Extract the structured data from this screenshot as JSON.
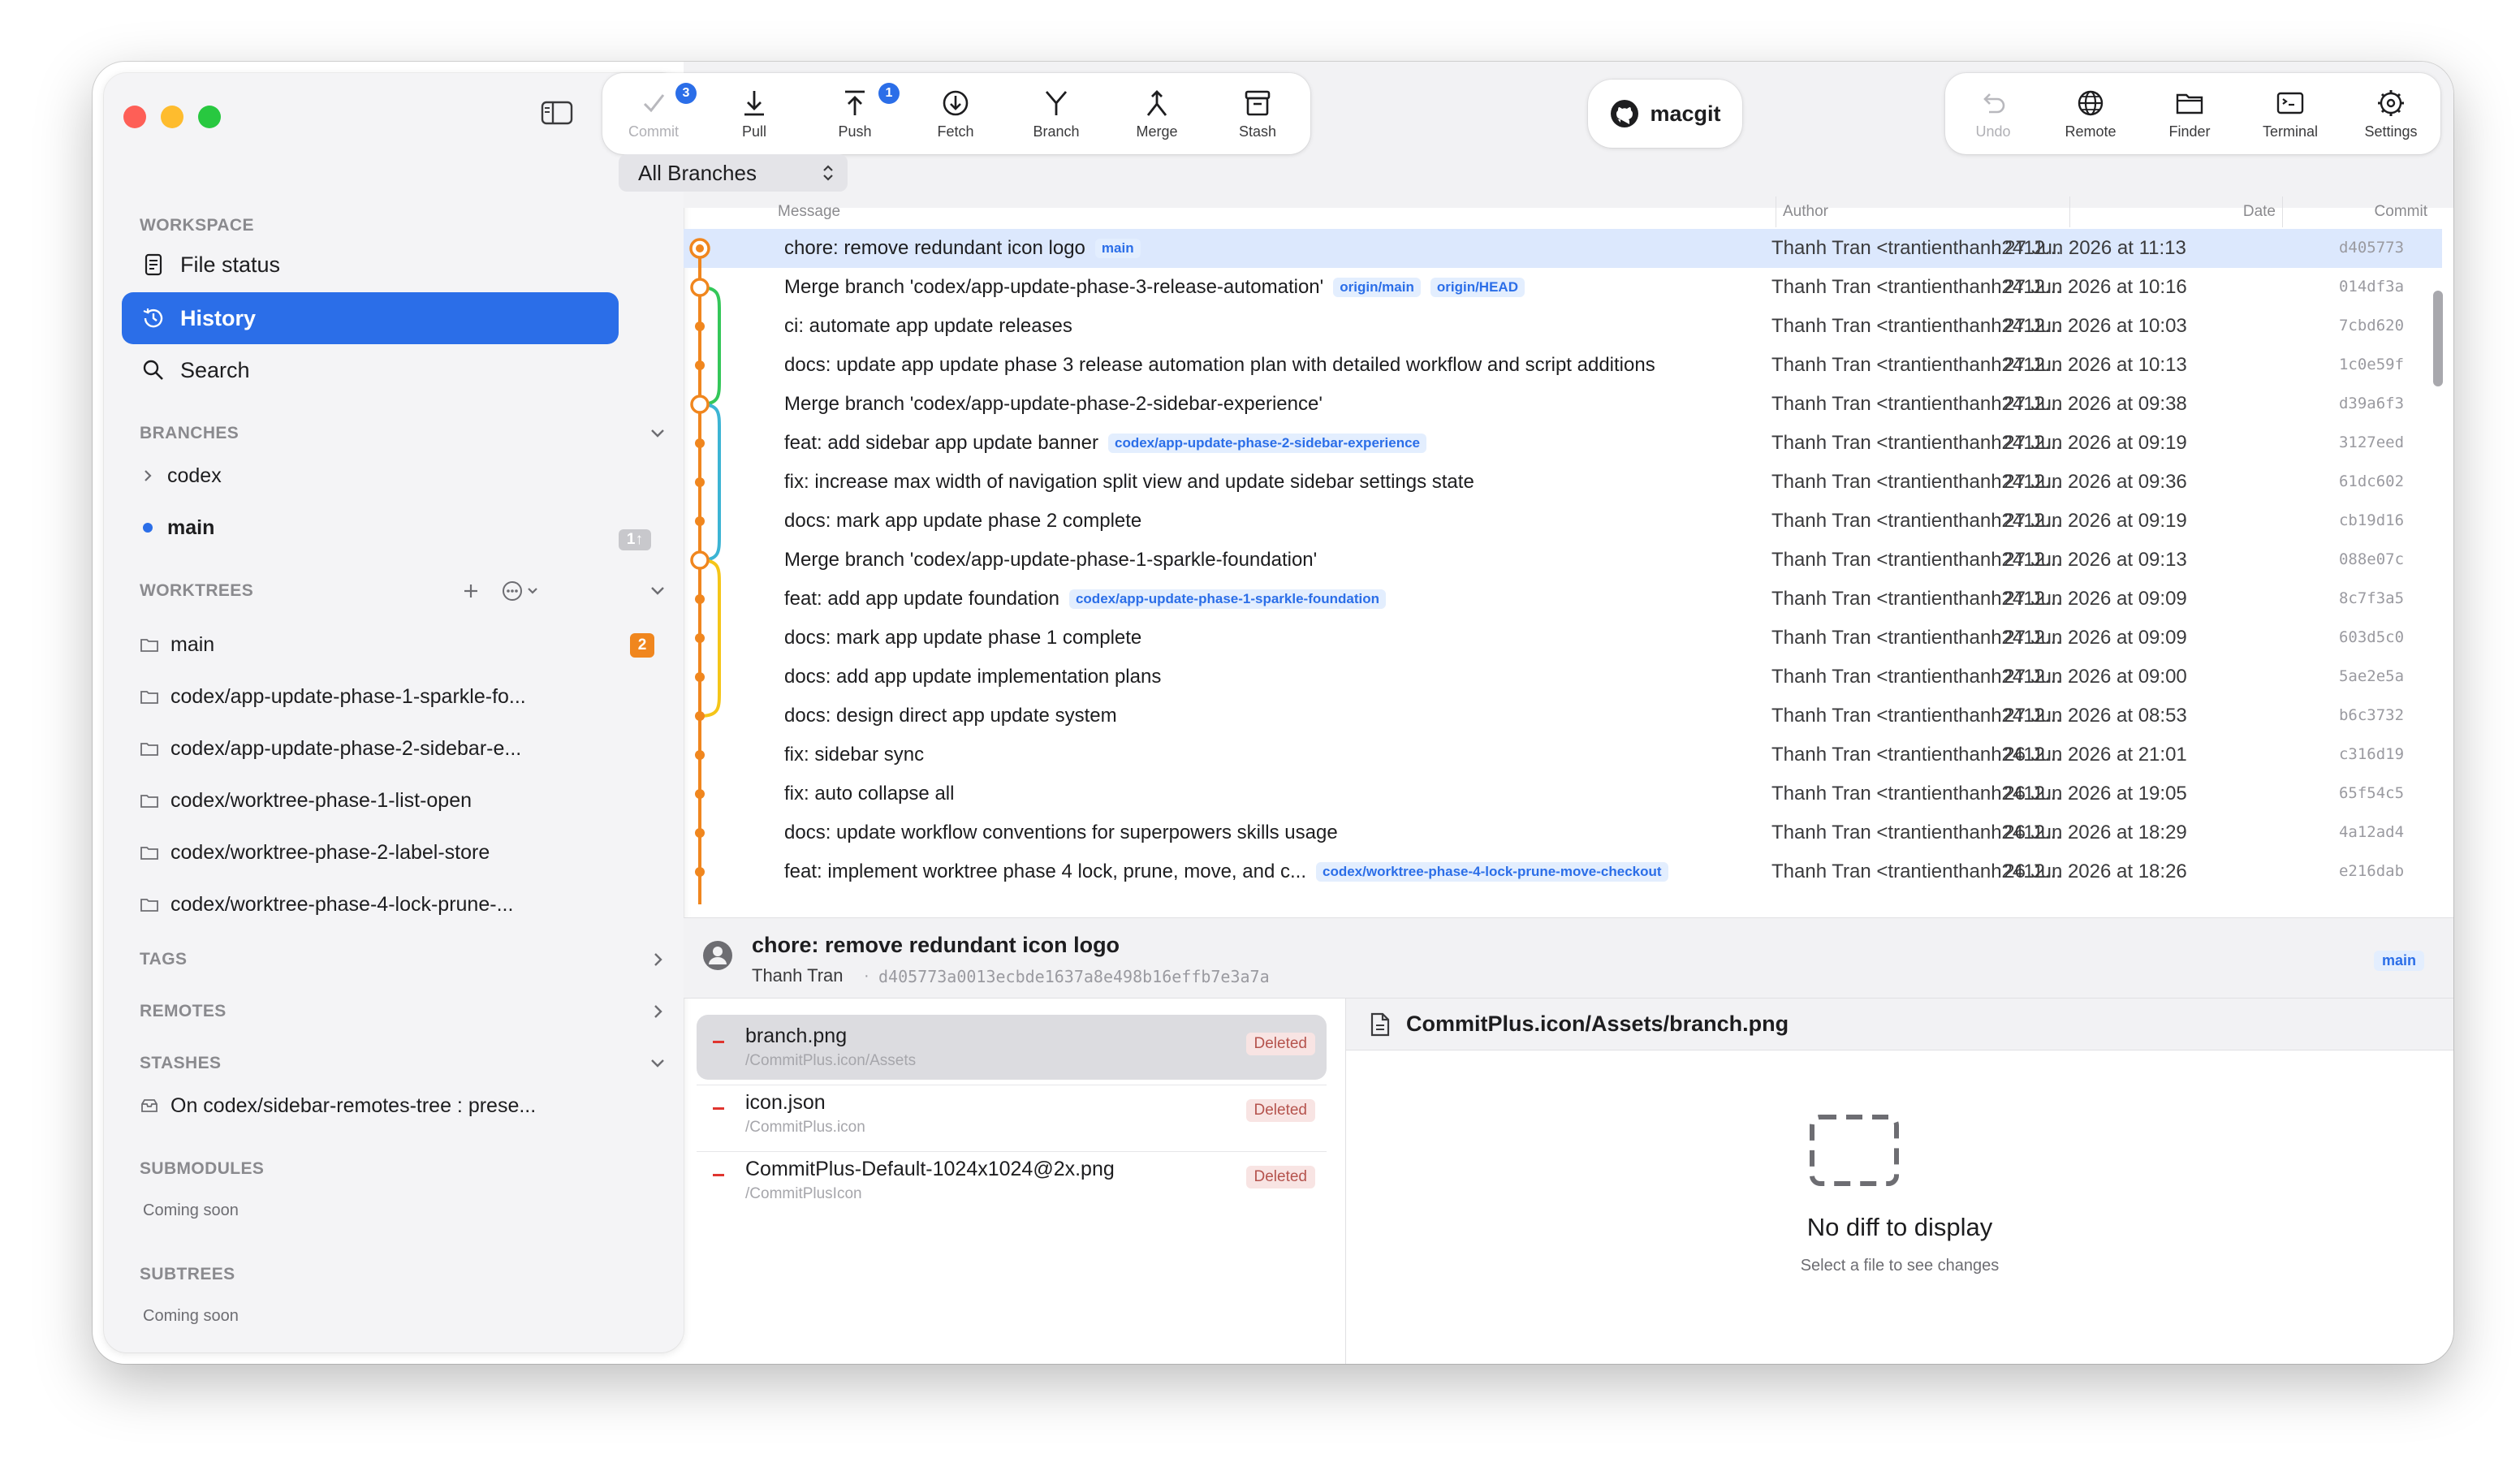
{
  "window": {
    "traffic_colors": [
      "#fe5f57",
      "#febc2e",
      "#28c840"
    ]
  },
  "sidebar": {
    "workspace_header": "WORKSPACE",
    "nav": [
      {
        "label": "File status",
        "icon": "file-status-icon"
      },
      {
        "label": "History",
        "icon": "history-icon",
        "active": true
      },
      {
        "label": "Search",
        "icon": "search-icon"
      }
    ],
    "branches_header": "BRANCHES",
    "branches": [
      {
        "label": "codex",
        "icon": "chevron-right-icon"
      },
      {
        "label": "main",
        "icon": "current-dot-icon",
        "badge": "1↑"
      }
    ],
    "worktrees_header": "WORKTREES",
    "worktrees": [
      {
        "label": "main",
        "badge": "2"
      },
      {
        "label": "codex/app-update-phase-1-sparkle-fo..."
      },
      {
        "label": "codex/app-update-phase-2-sidebar-e..."
      },
      {
        "label": "codex/worktree-phase-1-list-open"
      },
      {
        "label": "codex/worktree-phase-2-label-store"
      },
      {
        "label": "codex/worktree-phase-4-lock-prune-..."
      }
    ],
    "tags_header": "TAGS",
    "remotes_header": "REMOTES",
    "stashes_header": "STASHES",
    "stashes": [
      {
        "label": "On codex/sidebar-remotes-tree : prese..."
      }
    ],
    "submodules_header": "SUBMODULES",
    "submodules_note": "Coming soon",
    "subtrees_header": "SUBTREES",
    "subtrees_note": "Coming soon"
  },
  "toolbar": {
    "left": [
      {
        "label": "Commit",
        "icon": "checkmark-icon",
        "disabled": true,
        "badge": "3"
      },
      {
        "label": "Pull",
        "icon": "pull-icon"
      },
      {
        "label": "Push",
        "icon": "push-icon",
        "badge": "1"
      },
      {
        "label": "Fetch",
        "icon": "fetch-icon"
      },
      {
        "label": "Branch",
        "icon": "branch-icon"
      },
      {
        "label": "Merge",
        "icon": "merge-icon"
      },
      {
        "label": "Stash",
        "icon": "stash-icon"
      }
    ],
    "repo_name": "macgit",
    "right": [
      {
        "label": "Undo",
        "icon": "undo-icon",
        "disabled": true
      },
      {
        "label": "Remote",
        "icon": "globe-icon"
      },
      {
        "label": "Finder",
        "icon": "folder-icon"
      },
      {
        "label": "Terminal",
        "icon": "terminal-icon"
      },
      {
        "label": "Settings",
        "icon": "gear-icon"
      }
    ]
  },
  "branch_filter": {
    "value": "All Branches"
  },
  "history": {
    "columns": {
      "message": "Message",
      "author": "Author",
      "date": "Date",
      "commit": "Commit"
    },
    "rows": [
      {
        "message": "chore: remove redundant icon logo",
        "refs": [
          "main"
        ],
        "author": "Thanh Tran <trantienthanh2412...",
        "date": "27 Jun 2026 at 11:13",
        "hash": "d405773",
        "selected": true
      },
      {
        "message": "Merge branch 'codex/app-update-phase-3-release-automation'",
        "refs": [
          "origin/main",
          "origin/HEAD"
        ],
        "author": "Thanh Tran <trantienthanh2412...",
        "date": "27 Jun 2026 at 10:16",
        "hash": "014df3a"
      },
      {
        "message": "ci: automate app update releases",
        "refs": [],
        "author": "Thanh Tran <trantienthanh2412...",
        "date": "27 Jun 2026 at 10:03",
        "hash": "7cbd620"
      },
      {
        "message": "docs: update app update phase 3 release automation plan with detailed workflow and script additions",
        "refs": [],
        "author": "Thanh Tran <trantienthanh2412...",
        "date": "27 Jun 2026 at 10:13",
        "hash": "1c0e59f"
      },
      {
        "message": "Merge branch 'codex/app-update-phase-2-sidebar-experience'",
        "refs": [],
        "author": "Thanh Tran <trantienthanh2412...",
        "date": "27 Jun 2026 at 09:38",
        "hash": "d39a6f3"
      },
      {
        "message": "feat: add sidebar app update banner",
        "refs": [
          "codex/app-update-phase-2-sidebar-experience"
        ],
        "author": "Thanh Tran <trantienthanh2412...",
        "date": "27 Jun 2026 at 09:19",
        "hash": "3127eed"
      },
      {
        "message": "fix: increase max width of navigation split view and update sidebar settings state",
        "refs": [],
        "author": "Thanh Tran <trantienthanh2412...",
        "date": "27 Jun 2026 at 09:36",
        "hash": "61dc602"
      },
      {
        "message": "docs: mark app update phase 2 complete",
        "refs": [],
        "author": "Thanh Tran <trantienthanh2412...",
        "date": "27 Jun 2026 at 09:19",
        "hash": "cb19d16"
      },
      {
        "message": "Merge branch 'codex/app-update-phase-1-sparkle-foundation'",
        "refs": [],
        "author": "Thanh Tran <trantienthanh2412...",
        "date": "27 Jun 2026 at 09:13",
        "hash": "088e07c"
      },
      {
        "message": "feat: add app update foundation",
        "refs": [
          "codex/app-update-phase-1-sparkle-foundation"
        ],
        "author": "Thanh Tran <trantienthanh2412...",
        "date": "27 Jun 2026 at 09:09",
        "hash": "8c7f3a5"
      },
      {
        "message": "docs: mark app update phase 1 complete",
        "refs": [],
        "author": "Thanh Tran <trantienthanh2412...",
        "date": "27 Jun 2026 at 09:09",
        "hash": "603d5c0"
      },
      {
        "message": "docs: add app update implementation plans",
        "refs": [],
        "author": "Thanh Tran <trantienthanh2412...",
        "date": "27 Jun 2026 at 09:00",
        "hash": "5ae2e5a"
      },
      {
        "message": "docs: design direct app update system",
        "refs": [],
        "author": "Thanh Tran <trantienthanh2412...",
        "date": "27 Jun 2026 at 08:53",
        "hash": "b6c3732"
      },
      {
        "message": "fix: sidebar sync",
        "refs": [],
        "author": "Thanh Tran <trantienthanh2412...",
        "date": "26 Jun 2026 at 21:01",
        "hash": "c316d19"
      },
      {
        "message": "fix: auto collapse all",
        "refs": [],
        "author": "Thanh Tran <trantienthanh2412...",
        "date": "26 Jun 2026 at 19:05",
        "hash": "65f54c5"
      },
      {
        "message": "docs: update workflow conventions for superpowers skills usage",
        "refs": [],
        "author": "Thanh Tran <trantienthanh2412...",
        "date": "26 Jun 2026 at 18:29",
        "hash": "4a12ad4"
      },
      {
        "message": "feat: implement worktree phase 4 lock, prune, move, and c...",
        "refs": [
          "codex/worktree-phase-4-lock-prune-move-checkout"
        ],
        "author": "Thanh Tran <trantienthanh2412...",
        "date": "26 Jun 2026 at 18:26",
        "hash": "e216dab"
      }
    ]
  },
  "commit_detail": {
    "title": "chore: remove redundant icon logo",
    "author": "Thanh Tran",
    "separator": "·",
    "full_hash": "d405773a0013ecbde1637a8e498b16effb7e3a7a",
    "ref": "main"
  },
  "files": [
    {
      "name": "branch.png",
      "path": "/CommitPlus.icon/Assets",
      "status": "Deleted",
      "selected": true
    },
    {
      "name": "icon.json",
      "path": "/CommitPlus.icon",
      "status": "Deleted"
    },
    {
      "name": "CommitPlus-Default-1024x1024@2x.png",
      "path": "/CommitPlusIcon",
      "status": "Deleted"
    }
  ],
  "diff": {
    "file_path": "CommitPlus.icon/Assets/branch.png",
    "empty_title": "No diff to display",
    "empty_subtitle": "Select a file to see changes"
  },
  "colors": {
    "accent": "#2b6ee8",
    "graph_orange": "#f0861e",
    "graph_green": "#34c759",
    "graph_cyan": "#3cb4d4",
    "graph_yellow": "#f5c518",
    "deleted": "#e0352f"
  }
}
